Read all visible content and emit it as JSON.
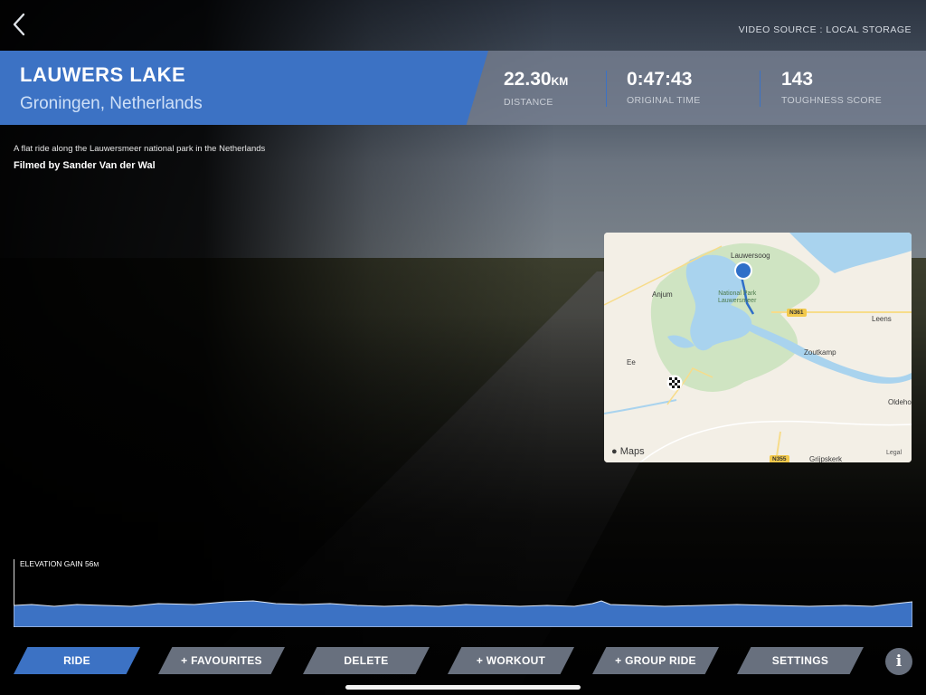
{
  "header": {
    "video_source": "VIDEO SOURCE : LOCAL STORAGE",
    "route_title": "LAUWERS LAKE",
    "route_location": "Groningen, Netherlands",
    "accent_color": "#3c72c4"
  },
  "stats": {
    "distance_value": "22.30",
    "distance_unit": "KM",
    "distance_label": "DISTANCE",
    "time_value": "0:47:43",
    "time_label": "ORIGINAL TIME",
    "toughness_value": "143",
    "toughness_label": "TOUGHNESS SCORE"
  },
  "description": {
    "text": "A flat ride along the Lauwersmeer national park in the Netherlands",
    "filmed_by": "Filmed by Sander Van der Wal"
  },
  "map": {
    "places": {
      "lauwersoog": "Lauwersoog",
      "anjum": "Anjum",
      "national_park_line1": "National Park",
      "national_park_line2": "Lauwersmeer",
      "leens": "Leens",
      "zoutkamp": "Zoutkamp",
      "ee": "Ee",
      "oldehove": "Oldeho",
      "grijpskerk": "Grijpskerk"
    },
    "road_n361": "N361",
    "road_n355": "N355",
    "brand": "Maps",
    "legal": "Legal",
    "position_marker_icon": "location-dot-icon",
    "finish_marker_icon": "checkered-flag-icon"
  },
  "elevation": {
    "label": "ELEVATION GAIN 56",
    "unit": "M"
  },
  "toolbar": {
    "ride": "RIDE",
    "favourites": "+ FAVOURITES",
    "delete": "DELETE",
    "workout": "+ WORKOUT",
    "group_ride": "+ GROUP RIDE",
    "settings": "SETTINGS",
    "info": "i"
  }
}
